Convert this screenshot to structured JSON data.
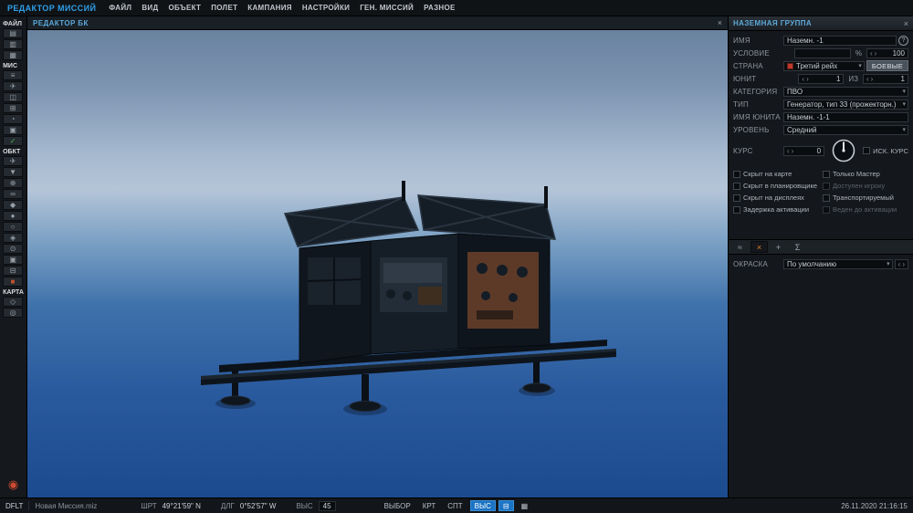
{
  "app": {
    "title": "РЕДАКТОР МИССИЙ"
  },
  "ui": {
    "caret": "▾",
    "close": "×",
    "help": "?",
    "spin_left": "‹",
    "spin_right": "›"
  },
  "colors": {
    "accent_blue": "#2f9fe8",
    "panel_title_blue": "#5da8da",
    "active_mode_blue": "#1c74c4",
    "country_flag_red": "#c0392b",
    "active_tab_orange": "#e08030",
    "check_green": "#4caf50"
  },
  "menu": {
    "items": [
      "ФАЙЛ",
      "ВИД",
      "ОБЪЕКТ",
      "ПОЛЕТ",
      "КАМПАНИЯ",
      "НАСТРОЙКИ",
      "ГЕН. МИССИЙ",
      "РАЗНОЕ"
    ]
  },
  "left_toolbar": {
    "sections": [
      {
        "label": "ФАЙЛ",
        "icons": [
          {
            "name": "file-new-icon",
            "glyph": "▤"
          },
          {
            "name": "file-open-icon",
            "glyph": "▥"
          },
          {
            "name": "file-save-icon",
            "glyph": "▦"
          }
        ]
      },
      {
        "label": "МИС",
        "icons": [
          {
            "name": "mission-properties-icon",
            "glyph": "≡"
          },
          {
            "name": "mission-flight-icon",
            "glyph": "✈"
          },
          {
            "name": "mission-weather-icon",
            "glyph": "◫"
          },
          {
            "name": "mission-grid-icon",
            "glyph": "⊞"
          },
          {
            "name": "mission-time-icon",
            "glyph": "◔"
          },
          {
            "name": "mission-description-icon",
            "glyph": "▣"
          },
          {
            "name": "mission-validate-icon",
            "glyph": "✓",
            "color": "#4caf50"
          }
        ]
      },
      {
        "label": "ОБКТ",
        "icons": [
          {
            "name": "object-aircraft-icon",
            "glyph": "✈"
          },
          {
            "name": "object-vehicle-icon",
            "glyph": "▼"
          },
          {
            "name": "object-artillery-icon",
            "glyph": "⊕"
          },
          {
            "name": "object-train-icon",
            "glyph": "∞"
          },
          {
            "name": "object-ship-icon",
            "glyph": "◆"
          },
          {
            "name": "object-waypoint-icon",
            "glyph": "●"
          },
          {
            "name": "object-zone-icon",
            "glyph": "○"
          },
          {
            "name": "object-effect-icon",
            "glyph": "◈"
          },
          {
            "name": "object-marker-icon",
            "glyph": "⊙"
          },
          {
            "name": "object-building-icon",
            "glyph": "▣"
          },
          {
            "name": "object-bridge-icon",
            "glyph": "⊟"
          },
          {
            "name": "object-delete-icon",
            "glyph": "■",
            "color": "#c2502e"
          }
        ]
      },
      {
        "label": "КАРТА",
        "icons": [
          {
            "name": "map-layer-icon",
            "glyph": "◇"
          },
          {
            "name": "map-ruler-icon",
            "glyph": "◎"
          }
        ]
      }
    ],
    "bottom_icon": {
      "glyph": "◉"
    }
  },
  "viewport": {
    "panel_title": "РЕДАКТОР БК"
  },
  "right_panel": {
    "title": "НАЗЕМНАЯ ГРУППА",
    "fields": {
      "name": {
        "label": "ИМЯ",
        "value": "Наземн. -1"
      },
      "condition": {
        "label": "УСЛОВИЕ",
        "value": "",
        "percent": "%",
        "spin_value": "100"
      },
      "country": {
        "label": "СТРАНА",
        "value": "Третий рейх",
        "button": "БОЕВЫЕ"
      },
      "unit": {
        "label": "ЮНИТ",
        "value": "1",
        "of_label": "ИЗ",
        "total": "1"
      },
      "category": {
        "label": "КАТЕГОРИЯ",
        "value": "ПВО"
      },
      "type": {
        "label": "ТИП",
        "value": "Генератор, тип 33 (прожекторн.)"
      },
      "unit_name": {
        "label": "ИМЯ ЮНИТА",
        "value": "Наземн. -1-1"
      },
      "level": {
        "label": "УРОВЕНЬ",
        "value": "Средний"
      },
      "course": {
        "label": "КУРС",
        "value": "0",
        "checkbox_label": "ИСК. КУРС"
      }
    },
    "checkboxes": {
      "left": [
        {
          "name": "hidden-on-map-checkbox",
          "label": "Скрыт на карте",
          "disabled": false
        },
        {
          "name": "hidden-in-planner-checkbox",
          "label": "Скрыт в планировщике",
          "disabled": false
        },
        {
          "name": "hidden-on-displays-checkbox",
          "label": "Скрыт на дисплеях",
          "disabled": false
        },
        {
          "name": "activation-delay-checkbox",
          "label": "Задержка активации",
          "disabled": false
        }
      ],
      "right": [
        {
          "name": "master-only-checkbox",
          "label": "Только Мастер",
          "disabled": false
        },
        {
          "name": "available-to-player-checkbox",
          "label": "Доступен игроку",
          "disabled": true
        },
        {
          "name": "transportable-checkbox",
          "label": "Транспортируемый",
          "disabled": false
        },
        {
          "name": "led-until-activation-checkbox",
          "label": "Веден до активации",
          "disabled": true
        }
      ]
    },
    "tool_tabs": [
      {
        "name": "spline-tab-icon",
        "glyph": "≈",
        "active": false
      },
      {
        "name": "links-tab-icon",
        "glyph": "×",
        "active": true
      },
      {
        "name": "chains-tab-icon",
        "glyph": "+",
        "active": false
      },
      {
        "name": "summary-tab-icon",
        "glyph": "Σ",
        "active": false
      }
    ],
    "paint": {
      "label": "ОКРАСКА",
      "value": "По умолчанию"
    }
  },
  "status_bar": {
    "profile": "DFLT",
    "mission_file": "Новая Миссия.miz",
    "lat_label": "ШРТ",
    "lat_value": "49°21'59\" N",
    "lon_label": "ДЛГ",
    "lon_value": "0°52'57\" W",
    "alt_label": "ВЫС",
    "alt_value": "45",
    "modes": [
      {
        "name": "select-mode-button",
        "label": "ВЫБОР",
        "active": false
      },
      {
        "name": "map-mode-button",
        "label": "КРТ",
        "active": false
      },
      {
        "name": "satellite-mode-button",
        "label": "СПТ",
        "active": false
      },
      {
        "name": "height-mode-button",
        "label": "ВЫС",
        "active": true
      }
    ],
    "toggles": [
      {
        "name": "layers-toggle-icon",
        "glyph": "⊟",
        "active": true
      },
      {
        "name": "grid-toggle-icon",
        "glyph": "▦",
        "active": false
      }
    ],
    "datetime": "26.11.2020 21:16:15"
  }
}
